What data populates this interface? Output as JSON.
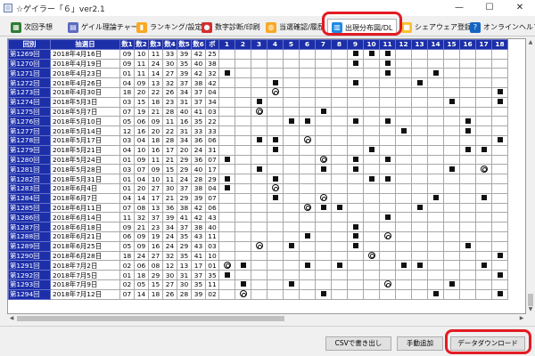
{
  "window": {
    "title": "☆ゲイラー「６」ver2.1",
    "controls": {
      "minimize": "—",
      "maximize": "☐",
      "close": "✕"
    }
  },
  "tabs": [
    {
      "label": "次回予想",
      "icon": "grid-icon",
      "color": "#2e7d32"
    },
    {
      "label": "ゲイル理論チャート",
      "icon": "document-icon",
      "color": "#5c6bc0"
    },
    {
      "label": "ランキング/設定",
      "icon": "bar-chart-icon",
      "color": "#f9a825"
    },
    {
      "label": "数字診断/印刷",
      "icon": "ladybug-icon",
      "color": "#d32f2f"
    },
    {
      "label": "当選確認/履歴",
      "icon": "coins-icon",
      "color": "#f9a825"
    },
    {
      "label": "出現分布図/DL",
      "icon": "book-icon",
      "color": "#1e88e5",
      "active": true
    },
    {
      "label": "シェアウェア登録",
      "icon": "lock-icon",
      "color": "#fbc02d"
    },
    {
      "label": "オンラインヘルプ",
      "icon": "help-icon",
      "color": "#1565c0"
    }
  ],
  "table": {
    "headers": [
      "回別",
      "抽選日",
      "数1",
      "数2",
      "数3",
      "数4",
      "数5",
      "数6",
      "ボ",
      "1",
      "2",
      "3",
      "4",
      "5",
      "6",
      "7",
      "8",
      "9",
      "10",
      "11",
      "12",
      "13",
      "14",
      "15",
      "16",
      "17",
      "18"
    ],
    "rows": [
      {
        "draw": "第1269回",
        "date": "2018年4月16日",
        "nums": [
          "09",
          "10",
          "11",
          "33",
          "39",
          "42"
        ],
        "bonus": "25"
      },
      {
        "draw": "第1270回",
        "date": "2018年4月19日",
        "nums": [
          "09",
          "11",
          "24",
          "30",
          "35",
          "40"
        ],
        "bonus": "38"
      },
      {
        "draw": "第1271回",
        "date": "2018年4月23日",
        "nums": [
          "01",
          "11",
          "14",
          "27",
          "39",
          "42"
        ],
        "bonus": "32"
      },
      {
        "draw": "第1272回",
        "date": "2018年4月26日",
        "nums": [
          "04",
          "09",
          "13",
          "32",
          "37",
          "38"
        ],
        "bonus": "42"
      },
      {
        "draw": "第1273回",
        "date": "2018年4月30日",
        "nums": [
          "18",
          "20",
          "22",
          "26",
          "34",
          "37"
        ],
        "bonus": "04"
      },
      {
        "draw": "第1274回",
        "date": "2018年5月3日",
        "nums": [
          "03",
          "15",
          "18",
          "23",
          "31",
          "37"
        ],
        "bonus": "34"
      },
      {
        "draw": "第1275回",
        "date": "2018年5月7日",
        "nums": [
          "07",
          "19",
          "21",
          "28",
          "40",
          "41"
        ],
        "bonus": "03"
      },
      {
        "draw": "第1276回",
        "date": "2018年5月10日",
        "nums": [
          "05",
          "06",
          "09",
          "11",
          "16",
          "35"
        ],
        "bonus": "22"
      },
      {
        "draw": "第1277回",
        "date": "2018年5月14日",
        "nums": [
          "12",
          "16",
          "20",
          "22",
          "31",
          "33"
        ],
        "bonus": "33"
      },
      {
        "draw": "第1278回",
        "date": "2018年5月17日",
        "nums": [
          "03",
          "04",
          "18",
          "28",
          "34",
          "36"
        ],
        "bonus": "06"
      },
      {
        "draw": "第1279回",
        "date": "2018年5月21日",
        "nums": [
          "04",
          "10",
          "16",
          "17",
          "20",
          "24"
        ],
        "bonus": "31"
      },
      {
        "draw": "第1280回",
        "date": "2018年5月24日",
        "nums": [
          "01",
          "09",
          "11",
          "21",
          "29",
          "36"
        ],
        "bonus": "07"
      },
      {
        "draw": "第1281回",
        "date": "2018年5月28日",
        "nums": [
          "03",
          "07",
          "09",
          "15",
          "29",
          "40"
        ],
        "bonus": "17"
      },
      {
        "draw": "第1282回",
        "date": "2018年5月31日",
        "nums": [
          "01",
          "04",
          "10",
          "11",
          "24",
          "28"
        ],
        "bonus": "29"
      },
      {
        "draw": "第1283回",
        "date": "2018年6月4日",
        "nums": [
          "01",
          "20",
          "27",
          "30",
          "37",
          "38"
        ],
        "bonus": "04"
      },
      {
        "draw": "第1284回",
        "date": "2018年6月7日",
        "nums": [
          "04",
          "14",
          "17",
          "21",
          "29",
          "39"
        ],
        "bonus": "07"
      },
      {
        "draw": "第1285回",
        "date": "2018年6月11日",
        "nums": [
          "07",
          "08",
          "13",
          "36",
          "38",
          "42"
        ],
        "bonus": "06"
      },
      {
        "draw": "第1286回",
        "date": "2018年6月14日",
        "nums": [
          "11",
          "32",
          "37",
          "39",
          "41",
          "42"
        ],
        "bonus": "43"
      },
      {
        "draw": "第1287回",
        "date": "2018年6月18日",
        "nums": [
          "09",
          "21",
          "23",
          "34",
          "37",
          "38"
        ],
        "bonus": "40"
      },
      {
        "draw": "第1288回",
        "date": "2018年6月21日",
        "nums": [
          "06",
          "09",
          "19",
          "24",
          "35",
          "43"
        ],
        "bonus": "11"
      },
      {
        "draw": "第1289回",
        "date": "2018年6月25日",
        "nums": [
          "05",
          "09",
          "16",
          "24",
          "29",
          "43"
        ],
        "bonus": "03"
      },
      {
        "draw": "第1290回",
        "date": "2018年6月28日",
        "nums": [
          "18",
          "24",
          "27",
          "32",
          "35",
          "41"
        ],
        "bonus": "10"
      },
      {
        "draw": "第1291回",
        "date": "2018年7月2日",
        "nums": [
          "02",
          "06",
          "08",
          "12",
          "13",
          "17"
        ],
        "bonus": "01"
      },
      {
        "draw": "第1292回",
        "date": "2018年7月5日",
        "nums": [
          "01",
          "18",
          "29",
          "30",
          "31",
          "37"
        ],
        "bonus": "35"
      },
      {
        "draw": "第1293回",
        "date": "2018年7月9日",
        "nums": [
          "02",
          "05",
          "15",
          "27",
          "30",
          "35"
        ],
        "bonus": "11"
      },
      {
        "draw": "第1294回",
        "date": "2018年7月12日",
        "nums": [
          "07",
          "14",
          "18",
          "26",
          "28",
          "39"
        ],
        "bonus": "02"
      }
    ]
  },
  "buttons": {
    "csv": "CSVで書き出し",
    "manual_add": "手動追加",
    "data_download": "データダウンロード"
  },
  "colors": {
    "header_bg": "#1c2fa8",
    "highlight": "#e31b23",
    "grid_line": "#a8a8a8"
  }
}
